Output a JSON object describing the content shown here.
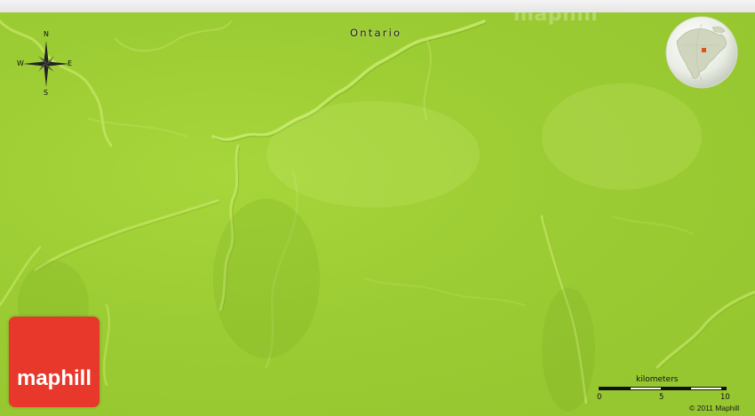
{
  "map": {
    "watermark": "maphill",
    "region_label": "Ontario",
    "compass": {
      "north": "N",
      "south": "S",
      "east": "E",
      "west": "W"
    },
    "logo_text": "maphill",
    "scale": {
      "unit": "kilometers",
      "ticks": [
        "0",
        "5",
        "10"
      ]
    },
    "copyright": "© 2011 Maphill",
    "colors": {
      "land": "#9ccc33",
      "logo": "#e8382b",
      "locator_marker": "#e05020"
    }
  }
}
